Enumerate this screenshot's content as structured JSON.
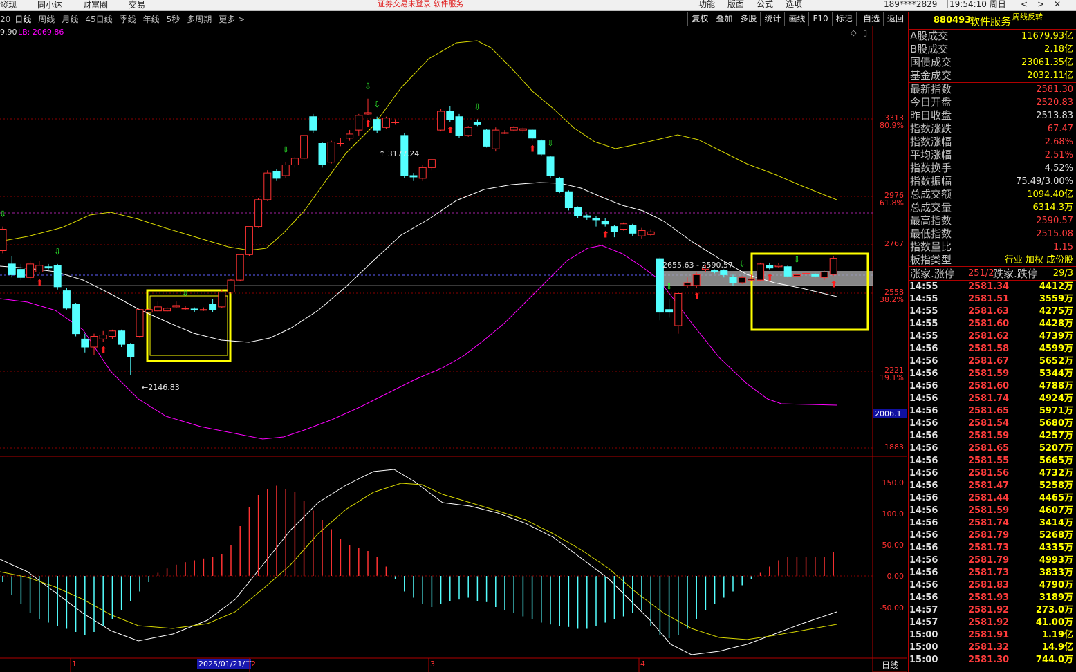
{
  "topbar": {
    "nav": [
      "發现",
      "同小达",
      "财富圈",
      "交易"
    ],
    "notice": "证券交易未登录  软件服务",
    "right_menu": [
      "功能",
      "版面",
      "公式",
      "选项"
    ],
    "account": "189****2829",
    "clock": "19:54:10 周日"
  },
  "toolbar": {
    "indicator_prefix": "20",
    "periods": [
      "日线",
      "周线",
      "月线",
      "45日线",
      "季线",
      "年线",
      "5秒",
      "多周期",
      "更多 >"
    ],
    "active_period": "日线",
    "tools": [
      "复权",
      "叠加",
      "多股",
      "统计",
      "画线",
      "F10",
      "标记",
      "-自选",
      "返回"
    ]
  },
  "chart": {
    "indicator_line": {
      "left": "9.90",
      "lb": "LB: 2069.86"
    },
    "price_axis": [
      {
        "price": "3313",
        "pct": "80.9%",
        "y": 135
      },
      {
        "price": "2976",
        "pct": "61.8%",
        "y": 247
      },
      {
        "price": "2767",
        "pct": "",
        "y": 317
      },
      {
        "price": "2558",
        "pct": "38.2%",
        "y": 387
      },
      {
        "price": "2221",
        "pct": "19.1%",
        "y": 500
      },
      {
        "price": "1883",
        "pct": "",
        "y": 611
      }
    ],
    "current_price_tag": "2006.1",
    "annotations": {
      "high": "3177.24",
      "low": "2146.83",
      "range": "2655.63 - 2590.57"
    },
    "macd_axis": [
      "150.0",
      "100.0",
      "50.00",
      "0.00",
      "-50.00"
    ],
    "x_axis": {
      "labels": [
        "1",
        "2025/01/21/二",
        "2",
        "3",
        "4"
      ],
      "period_box": "日线"
    },
    "colors": {
      "up": "#ff3232",
      "down": "#54ffff",
      "ma_yellow": "#ffff00",
      "ma_white": "#ffffff",
      "ma_magenta": "#ff00ff",
      "grid": "#8b0000"
    }
  },
  "chart_data": {
    "type": "candlestick",
    "title": "",
    "ylim": [
      1850,
      3450
    ],
    "candles": [
      {
        "o": 2610,
        "c": 2690,
        "h": 2700,
        "l": 2600
      },
      {
        "o": 2560,
        "c": 2520,
        "h": 2590,
        "l": 2510
      },
      {
        "o": 2540,
        "c": 2510,
        "h": 2560,
        "l": 2500
      },
      {
        "o": 2510,
        "c": 2560,
        "h": 2570,
        "l": 2500
      },
      {
        "o": 2530,
        "c": 2555,
        "h": 2570,
        "l": 2520
      },
      {
        "o": 2550,
        "c": 2545,
        "h": 2560,
        "l": 2540
      },
      {
        "o": 2555,
        "c": 2475,
        "h": 2560,
        "l": 2465
      },
      {
        "o": 2460,
        "c": 2395,
        "h": 2470,
        "l": 2390
      },
      {
        "o": 2410,
        "c": 2300,
        "h": 2415,
        "l": 2290
      },
      {
        "o": 2280,
        "c": 2250,
        "h": 2300,
        "l": 2230
      },
      {
        "o": 2250,
        "c": 2290,
        "h": 2300,
        "l": 2220
      },
      {
        "o": 2280,
        "c": 2295,
        "h": 2310,
        "l": 2270
      },
      {
        "o": 2290,
        "c": 2310,
        "h": 2315,
        "l": 2280
      },
      {
        "o": 2310,
        "c": 2260,
        "h": 2315,
        "l": 2250
      },
      {
        "o": 2260,
        "c": 2215,
        "h": 2265,
        "l": 2146.83
      },
      {
        "o": 2290,
        "c": 2390,
        "h": 2390,
        "l": 2285
      },
      {
        "o": 2380,
        "c": 2390,
        "h": 2395,
        "l": 2375
      },
      {
        "o": 2385,
        "c": 2400,
        "h": 2420,
        "l": 2380
      },
      {
        "o": 2385,
        "c": 2395,
        "h": 2400,
        "l": 2380
      },
      {
        "o": 2400,
        "c": 2405,
        "h": 2420,
        "l": 2395
      },
      {
        "o": 2395,
        "c": 2395,
        "h": 2405,
        "l": 2388
      },
      {
        "o": 2392,
        "c": 2388,
        "h": 2398,
        "l": 2380
      },
      {
        "o": 2390,
        "c": 2390,
        "h": 2398,
        "l": 2385
      },
      {
        "o": 2410,
        "c": 2390,
        "h": 2430,
        "l": 2380
      },
      {
        "o": 2400,
        "c": 2455,
        "h": 2465,
        "l": 2395
      },
      {
        "o": 2455,
        "c": 2500,
        "h": 2505,
        "l": 2450
      },
      {
        "o": 2500,
        "c": 2595,
        "h": 2595,
        "l": 2495
      },
      {
        "o": 2595,
        "c": 2700,
        "h": 2700,
        "l": 2590
      },
      {
        "o": 2700,
        "c": 2800,
        "h": 2805,
        "l": 2695
      },
      {
        "o": 2800,
        "c": 2900,
        "h": 2910,
        "l": 2795
      },
      {
        "o": 2905,
        "c": 2880,
        "h": 2915,
        "l": 2870
      },
      {
        "o": 2890,
        "c": 2930,
        "h": 2940,
        "l": 2880
      },
      {
        "o": 2930,
        "c": 2955,
        "h": 2960,
        "l": 2920
      },
      {
        "o": 2955,
        "c": 3040,
        "h": 3040,
        "l": 2950
      },
      {
        "o": 3110,
        "c": 3060,
        "h": 3120,
        "l": 3050
      },
      {
        "o": 3010,
        "c": 2930,
        "h": 3015,
        "l": 2920
      },
      {
        "o": 2940,
        "c": 3015,
        "h": 3020,
        "l": 2935
      },
      {
        "o": 3010,
        "c": 3010,
        "h": 3030,
        "l": 3000
      },
      {
        "o": 3030,
        "c": 3045,
        "h": 3060,
        "l": 3020
      },
      {
        "o": 3060,
        "c": 3115,
        "h": 3120,
        "l": 3040
      },
      {
        "o": 3120,
        "c": 3125,
        "h": 3177.24,
        "l": 3115
      },
      {
        "o": 3100,
        "c": 3060,
        "h": 3110,
        "l": 3050
      },
      {
        "o": 3070,
        "c": 3105,
        "h": 3110,
        "l": 3065
      },
      {
        "o": 3090,
        "c": 3090,
        "h": 3100,
        "l": 3080
      },
      {
        "o": 3040,
        "c": 2890,
        "h": 3050,
        "l": 2880
      },
      {
        "o": 2890,
        "c": 2885,
        "h": 2900,
        "l": 2870
      },
      {
        "o": 2880,
        "c": 2920,
        "h": 2930,
        "l": 2870
      },
      {
        "o": 2920,
        "c": 2950,
        "h": 2950,
        "l": 2910
      },
      {
        "o": 3060,
        "c": 3130,
        "h": 3140,
        "l": 3055
      },
      {
        "o": 3130,
        "c": 3100,
        "h": 3150,
        "l": 3090
      },
      {
        "o": 3110,
        "c": 3040,
        "h": 3120,
        "l": 3030
      },
      {
        "o": 3040,
        "c": 3070,
        "h": 3075,
        "l": 3035
      },
      {
        "o": 3090,
        "c": 3080,
        "h": 3100,
        "l": 3075
      },
      {
        "o": 3060,
        "c": 3000,
        "h": 3065,
        "l": 2995
      },
      {
        "o": 2990,
        "c": 3060,
        "h": 3070,
        "l": 2980
      },
      {
        "o": 3050,
        "c": 3050,
        "h": 3060,
        "l": 3045
      },
      {
        "o": 3060,
        "c": 3070,
        "h": 3075,
        "l": 3055
      },
      {
        "o": 3060,
        "c": 3065,
        "h": 3070,
        "l": 3050
      },
      {
        "o": 3060,
        "c": 3030,
        "h": 3065,
        "l": 3020
      },
      {
        "o": 3020,
        "c": 2970,
        "h": 3025,
        "l": 2965
      },
      {
        "o": 2960,
        "c": 2890,
        "h": 2965,
        "l": 2880
      },
      {
        "o": 2880,
        "c": 2830,
        "h": 2885,
        "l": 2825
      },
      {
        "o": 2830,
        "c": 2770,
        "h": 2835,
        "l": 2760
      },
      {
        "o": 2770,
        "c": 2740,
        "h": 2775,
        "l": 2730
      },
      {
        "o": 2740,
        "c": 2735,
        "h": 2745,
        "l": 2725
      },
      {
        "o": 2730,
        "c": 2725,
        "h": 2740,
        "l": 2700
      },
      {
        "o": 2720,
        "c": 2710,
        "h": 2730,
        "l": 2700
      },
      {
        "o": 2700,
        "c": 2680,
        "h": 2705,
        "l": 2660
      },
      {
        "o": 2690,
        "c": 2710,
        "h": 2715,
        "l": 2685
      },
      {
        "o": 2705,
        "c": 2675,
        "h": 2710,
        "l": 2665
      },
      {
        "o": 2665,
        "c": 2685,
        "h": 2695,
        "l": 2655.63
      },
      {
        "o": 2670,
        "c": 2680,
        "h": 2690,
        "l": 2665
      },
      {
        "o": 2580,
        "c": 2380,
        "h": 2585,
        "l": 2350
      },
      {
        "o": 2390,
        "c": 2380,
        "h": 2430,
        "l": 2360
      },
      {
        "o": 2330,
        "c": 2450,
        "h": 2455,
        "l": 2300
      },
      {
        "o": 2480,
        "c": 2490,
        "h": 2510,
        "l": 2470
      },
      {
        "o": 2480,
        "c": 2520,
        "h": 2530,
        "l": 2470
      },
      {
        "o": 2540,
        "c": 2545,
        "h": 2555,
        "l": 2530
      },
      {
        "o": 2535,
        "c": 2530,
        "h": 2540,
        "l": 2525
      },
      {
        "o": 2535,
        "c": 2520,
        "h": 2540,
        "l": 2510
      },
      {
        "o": 2510,
        "c": 2490,
        "h": 2520,
        "l": 2480
      },
      {
        "o": 2490,
        "c": 2510,
        "h": 2515,
        "l": 2485
      },
      {
        "o": 2500,
        "c": 2505,
        "h": 2520,
        "l": 2495
      },
      {
        "o": 2500,
        "c": 2560,
        "h": 2565,
        "l": 2495
      },
      {
        "o": 2555,
        "c": 2545,
        "h": 2565,
        "l": 2540
      },
      {
        "o": 2550,
        "c": 2555,
        "h": 2565,
        "l": 2545
      },
      {
        "o": 2550,
        "c": 2515,
        "h": 2555,
        "l": 2510
      },
      {
        "o": 2515,
        "c": 2520,
        "h": 2530,
        "l": 2510
      },
      {
        "o": 2525,
        "c": 2525,
        "h": 2530,
        "l": 2520
      },
      {
        "o": 2520,
        "c": 2515,
        "h": 2525,
        "l": 2510
      },
      {
        "o": 2510,
        "c": 2530,
        "h": 2535,
        "l": 2500
      },
      {
        "o": 2520.83,
        "c": 2581.3,
        "h": 2590.57,
        "l": 2515.08
      }
    ],
    "macd_hist": [
      -10,
      -30,
      -45,
      -60,
      -70,
      -75,
      -80,
      -85,
      -90,
      -95,
      -90,
      -80,
      -70,
      -55,
      -40,
      -25,
      -10,
      5,
      12,
      18,
      22,
      25,
      28,
      30,
      35,
      50,
      80,
      110,
      130,
      140,
      145,
      140,
      135,
      120,
      105,
      90,
      75,
      60,
      50,
      45,
      40,
      30,
      15,
      -5,
      -25,
      -35,
      -45,
      -50,
      -45,
      -40,
      -38,
      -35,
      -40,
      -42,
      -50,
      -55,
      -60,
      -65,
      -70,
      -75,
      -78,
      -80,
      -82,
      -85,
      -85,
      -80,
      -75,
      -70,
      -65,
      -60,
      -55,
      -80,
      -95,
      -100,
      -95,
      -85,
      -70,
      -55,
      -45,
      -35,
      -25,
      -15,
      -5,
      5,
      15,
      25,
      30,
      30,
      30,
      30,
      30,
      38
    ]
  },
  "panel": {
    "code": "880493",
    "name": "软件服务",
    "tag": "周线反转",
    "volumes": [
      {
        "k": "A股成交",
        "v": "11679.93亿",
        "c": "#ffff00"
      },
      {
        "k": "B股成交",
        "v": "2.18亿",
        "c": "#ffff00"
      },
      {
        "k": "国债成交",
        "v": "23061.35亿",
        "c": "#ffff00"
      },
      {
        "k": "基金成交",
        "v": "2032.11亿",
        "c": "#ffff00"
      }
    ],
    "stats": [
      {
        "k": "最新指数",
        "v": "2581.30",
        "c": "#ff3c3c"
      },
      {
        "k": "今日开盘",
        "v": "2520.83",
        "c": "#ff3c3c"
      },
      {
        "k": "昨日收盘",
        "v": "2513.83",
        "c": "#e0e0e0"
      },
      {
        "k": "指数涨跌",
        "v": "67.47",
        "c": "#ff3c3c"
      },
      {
        "k": "指数涨幅",
        "v": "2.68%",
        "c": "#ff3c3c"
      },
      {
        "k": "平均涨幅",
        "v": "2.51%",
        "c": "#ff3c3c"
      },
      {
        "k": "指数换手",
        "v": "4.52%",
        "c": "#e0e0e0"
      },
      {
        "k": "指数振幅",
        "v": "75.49/3.00%",
        "c": "#e0e0e0"
      },
      {
        "k": "总成交额",
        "v": "1094.40亿",
        "c": "#ffff00"
      },
      {
        "k": "总成交量",
        "v": "6314.3万",
        "c": "#ffff00"
      },
      {
        "k": "最高指数",
        "v": "2590.57",
        "c": "#ff3c3c"
      },
      {
        "k": "最低指数",
        "v": "2515.08",
        "c": "#ff3c3c"
      },
      {
        "k": "指数量比",
        "v": "1.15",
        "c": "#ff3c3c"
      }
    ],
    "type_row": {
      "k": "板指类型",
      "v": "行业 加权 成份股"
    },
    "limits": {
      "up_label": "涨家.涨停",
      "up_val": "251/2",
      "down_label": "跌家.跌停",
      "down_val": "29/3"
    },
    "ticks": [
      {
        "t": "14:55",
        "p": "2581.34",
        "v": "4412万"
      },
      {
        "t": "14:55",
        "p": "2581.51",
        "v": "3559万"
      },
      {
        "t": "14:55",
        "p": "2581.63",
        "v": "4275万"
      },
      {
        "t": "14:55",
        "p": "2581.60",
        "v": "4428万"
      },
      {
        "t": "14:55",
        "p": "2581.62",
        "v": "4739万"
      },
      {
        "t": "14:56",
        "p": "2581.58",
        "v": "4599万"
      },
      {
        "t": "14:56",
        "p": "2581.67",
        "v": "5652万"
      },
      {
        "t": "14:56",
        "p": "2581.59",
        "v": "5344万"
      },
      {
        "t": "14:56",
        "p": "2581.60",
        "v": "4788万"
      },
      {
        "t": "14:56",
        "p": "2581.74",
        "v": "4924万"
      },
      {
        "t": "14:56",
        "p": "2581.65",
        "v": "5971万"
      },
      {
        "t": "14:56",
        "p": "2581.54",
        "v": "5680万"
      },
      {
        "t": "14:56",
        "p": "2581.59",
        "v": "4257万"
      },
      {
        "t": "14:56",
        "p": "2581.65",
        "v": "5207万"
      },
      {
        "t": "14:56",
        "p": "2581.55",
        "v": "5665万"
      },
      {
        "t": "14:56",
        "p": "2581.56",
        "v": "4732万"
      },
      {
        "t": "14:56",
        "p": "2581.47",
        "v": "5258万"
      },
      {
        "t": "14:56",
        "p": "2581.44",
        "v": "4465万"
      },
      {
        "t": "14:56",
        "p": "2581.59",
        "v": "4607万"
      },
      {
        "t": "14:56",
        "p": "2581.74",
        "v": "3414万"
      },
      {
        "t": "14:56",
        "p": "2581.79",
        "v": "5268万"
      },
      {
        "t": "14:56",
        "p": "2581.73",
        "v": "4335万"
      },
      {
        "t": "14:56",
        "p": "2581.79",
        "v": "4993万"
      },
      {
        "t": "14:56",
        "p": "2581.73",
        "v": "3833万"
      },
      {
        "t": "14:56",
        "p": "2581.83",
        "v": "4790万"
      },
      {
        "t": "14:56",
        "p": "2581.93",
        "v": "3189万"
      },
      {
        "t": "14:57",
        "p": "2581.92",
        "v": "273.0万"
      },
      {
        "t": "14:57",
        "p": "2581.92",
        "v": "41.00万"
      },
      {
        "t": "15:00",
        "p": "2581.91",
        "v": "1.19亿"
      },
      {
        "t": "15:00",
        "p": "2581.32",
        "v": "14.9亿"
      },
      {
        "t": "15:00",
        "p": "2581.30",
        "v": "744.0万"
      }
    ]
  }
}
